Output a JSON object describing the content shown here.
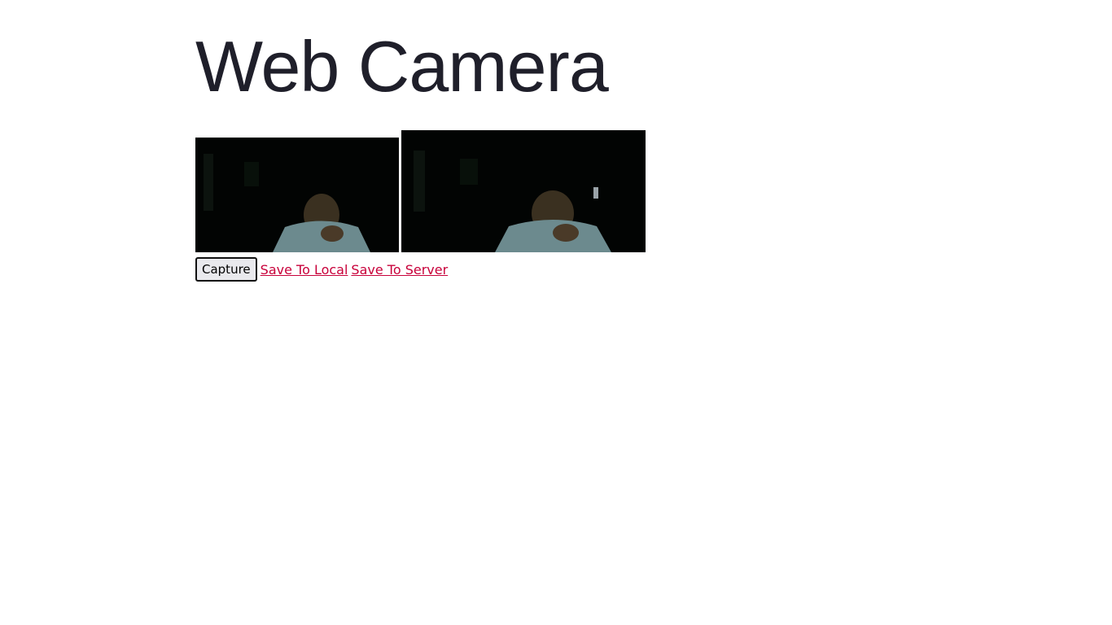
{
  "page": {
    "title": "Web Camera"
  },
  "feeds": {
    "video_alt": "live webcam video",
    "snapshot_alt": "captured snapshot"
  },
  "controls": {
    "capture_label": "Capture",
    "save_local_label": "Save To Local",
    "save_server_label": "Save To Server"
  },
  "colors": {
    "link": "#c8003a",
    "title": "#1f1f2a",
    "feed_bg": "#020403"
  }
}
